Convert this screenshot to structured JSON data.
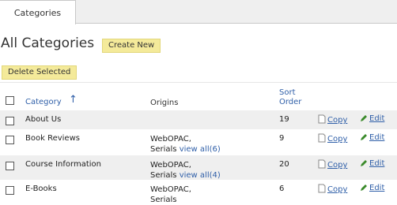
{
  "tabs": [
    {
      "label": "Categories"
    }
  ],
  "page_title": "All Categories",
  "buttons": {
    "create_new": "Create New",
    "delete_selected": "Delete Selected"
  },
  "table": {
    "headers": {
      "category": "Category",
      "origins": "Origins",
      "sort_order_line1": "Sort",
      "sort_order_line2": "Order"
    },
    "rows": [
      {
        "name": "About Us",
        "origins_line1": "",
        "origins_line2": "",
        "view_all": "",
        "sort": "19",
        "copy": "Copy",
        "edit": "Edit"
      },
      {
        "name": "Book Reviews",
        "origins_line1": "WebOPAC,",
        "origins_line2": "Serials",
        "view_all": "view all(6)",
        "sort": "9",
        "copy": "Copy",
        "edit": "Edit"
      },
      {
        "name": "Course Information",
        "origins_line1": "WebOPAC,",
        "origins_line2": "Serials",
        "view_all": "view all(4)",
        "sort": "20",
        "copy": "Copy",
        "edit": "Edit"
      },
      {
        "name": "E-Books",
        "origins_line1": "WebOPAC,",
        "origins_line2": "Serials",
        "view_all": "",
        "sort": "6",
        "copy": "Copy",
        "edit": "Edit"
      }
    ]
  },
  "colors": {
    "link": "#2f5fa8",
    "button_bg": "#f4ea9a",
    "alt_row": "#efefef"
  },
  "icons": {
    "sort": "sort-ascending-arrow-icon",
    "copy": "copy-document-icon",
    "edit": "pencil-edit-icon"
  }
}
